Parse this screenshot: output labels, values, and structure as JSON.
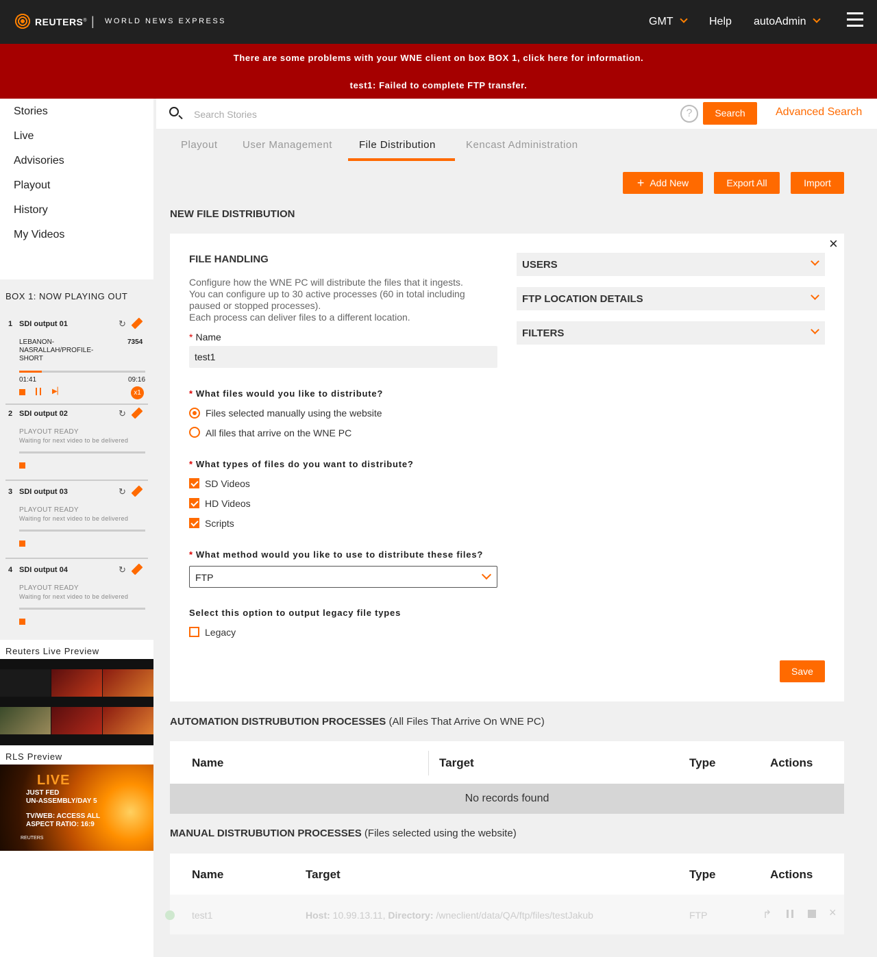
{
  "header": {
    "brand": "REUTERS",
    "brand_mark": "®",
    "separator": "|",
    "subtitle": "WORLD NEWS EXPRESS",
    "timezone": "GMT",
    "help": "Help",
    "user": "autoAdmin"
  },
  "alert": {
    "line1": "There are some problems with your WNE client on box BOX 1, click here for information.",
    "line2": "test1: Failed to complete FTP transfer."
  },
  "nav": [
    "Stories",
    "Live",
    "Advisories",
    "Playout",
    "History",
    "My Videos"
  ],
  "now_playing": {
    "title": "BOX 1: NOW PLAYING OUT",
    "outputs": [
      {
        "num": "1",
        "name": "SDI output 01",
        "story": "LEBANON-NASRALLAH/PROFILE-SHORT",
        "id": "7354",
        "elapsed": "01:41",
        "duration": "09:16",
        "speed": "x1",
        "progress": 0.18
      },
      {
        "num": "2",
        "name": "SDI output 02",
        "status": "PLAYOUT READY",
        "detail": "Waiting for next video to be delivered"
      },
      {
        "num": "3",
        "name": "SDI output 03",
        "status": "PLAYOUT READY",
        "detail": "Waiting for next video to be delivered"
      },
      {
        "num": "4",
        "name": "SDI output 04",
        "status": "PLAYOUT READY",
        "detail": "Waiting for next video to be delivered"
      }
    ]
  },
  "live_preview": {
    "title": "Reuters Live Preview"
  },
  "rls_preview": {
    "title": "RLS Preview",
    "live": "LIVE",
    "line1": "JUST FED",
    "line2": "UN-ASSEMBLY/DAY 5",
    "line3": "TV/WEB: ACCESS ALL",
    "line4": "ASPECT RATIO: 16:9",
    "logo": "REUTERS"
  },
  "search": {
    "placeholder": "Search Stories",
    "help": "?",
    "button": "Search",
    "advanced": "Advanced Search"
  },
  "tabs": [
    "Playout",
    "User Management",
    "File Distribution",
    "Kencast Administration"
  ],
  "active_tab": "File Distribution",
  "actions": {
    "add_new": "Add New",
    "export_all": "Export All",
    "import": "Import"
  },
  "form": {
    "section_title": "NEW FILE DISTRIBUTION",
    "close": "×",
    "handling_title": "FILE HANDLING",
    "desc1": "Configure how the WNE PC will distribute the files that it ingests.",
    "desc2": "You can configure up to 30 active processes (60 in total including",
    "desc3": "paused or stopped processes).",
    "desc4": "Each process can deliver files to a different location.",
    "req": "*",
    "name_label": "Name",
    "name_value": "test1",
    "q1": "What files would you like to distribute?",
    "q1_opts": [
      "Files selected manually using the website",
      "All files that arrive on the WNE PC"
    ],
    "q2": "What types of files do you want to distribute?",
    "q2_opts": [
      "SD Videos",
      "HD Videos",
      "Scripts"
    ],
    "q3": "What method would you like to use to distribute these files?",
    "method": "FTP",
    "legacy_q": "Select this option to output legacy file types",
    "legacy": "Legacy",
    "save": "Save",
    "accordions": [
      "USERS",
      "FTP LOCATION DETAILS",
      "FILTERS"
    ]
  },
  "automation": {
    "title": "AUTOMATION DISTRUBUTION PROCESSES",
    "subtitle": "(All Files That Arrive On WNE PC)",
    "cols": [
      "Name",
      "Target",
      "Type",
      "Actions"
    ],
    "empty": "No records found"
  },
  "manual": {
    "title": "MANUAL DISTRUBUTION PROCESSES",
    "subtitle": "(Files selected using the website)",
    "cols": [
      "Name",
      "Target",
      "Type",
      "Actions"
    ],
    "rows": [
      {
        "name": "test1",
        "host_label": "Host:",
        "host": "10.99.13.11,",
        "dir_label": "Directory:",
        "dir": "/wneclient/data/QA/ftp/files/testJakub",
        "type": "FTP"
      }
    ]
  }
}
